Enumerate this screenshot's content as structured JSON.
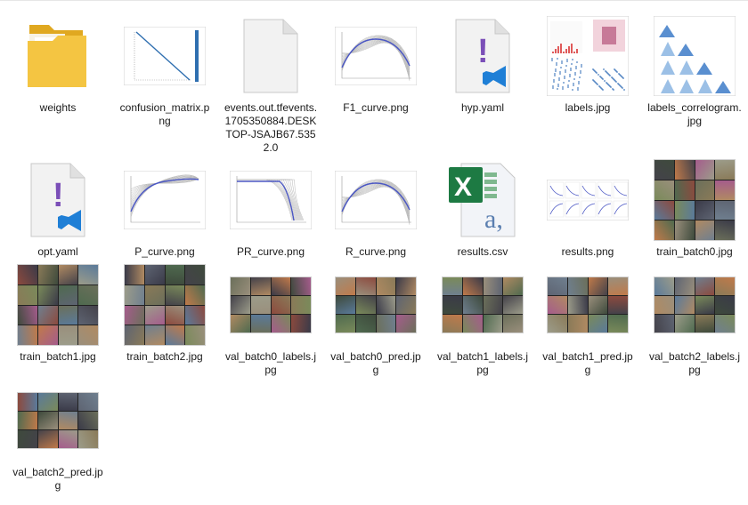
{
  "files": [
    {
      "name": "weights",
      "kind": "folder"
    },
    {
      "name": "confusion_matrix.png",
      "kind": "confusion"
    },
    {
      "name": "events.out.tfevents.1705350884.DESKTOP-JSAJB67.5352.0",
      "kind": "blank"
    },
    {
      "name": "F1_curve.png",
      "kind": "curve"
    },
    {
      "name": "hyp.yaml",
      "kind": "yaml"
    },
    {
      "name": "labels.jpg",
      "kind": "labels"
    },
    {
      "name": "labels_correlogram.jpg",
      "kind": "correlogram"
    },
    {
      "name": "opt.yaml",
      "kind": "yaml"
    },
    {
      "name": "P_curve.png",
      "kind": "pcurve"
    },
    {
      "name": "PR_curve.png",
      "kind": "prcurve"
    },
    {
      "name": "R_curve.png",
      "kind": "curve"
    },
    {
      "name": "results.csv",
      "kind": "excel"
    },
    {
      "name": "results.png",
      "kind": "results"
    },
    {
      "name": "train_batch0.jpg",
      "kind": "mosaic"
    },
    {
      "name": "train_batch1.jpg",
      "kind": "mosaic"
    },
    {
      "name": "train_batch2.jpg",
      "kind": "mosaic"
    },
    {
      "name": "val_batch0_labels.jpg",
      "kind": "mosaic-wide"
    },
    {
      "name": "val_batch0_pred.jpg",
      "kind": "mosaic-wide"
    },
    {
      "name": "val_batch1_labels.jpg",
      "kind": "mosaic-wide"
    },
    {
      "name": "val_batch1_pred.jpg",
      "kind": "mosaic-wide"
    },
    {
      "name": "val_batch2_labels.jpg",
      "kind": "mosaic-wide"
    },
    {
      "name": "val_batch2_pred.jpg",
      "kind": "mosaic-wide"
    }
  ],
  "colors": {
    "folder": "#f4c542",
    "folder_dark": "#e0a820",
    "yaml_mark": "#7b4fb8",
    "vscode": "#1f7fd6",
    "excel": "#1d7a43",
    "curve": "#4b57c4"
  },
  "icons": {
    "folder": "folder-icon",
    "yaml": "yaml-file-icon",
    "excel": "excel-file-icon",
    "blank": "blank-file-icon",
    "image": "image-thumbnail"
  }
}
